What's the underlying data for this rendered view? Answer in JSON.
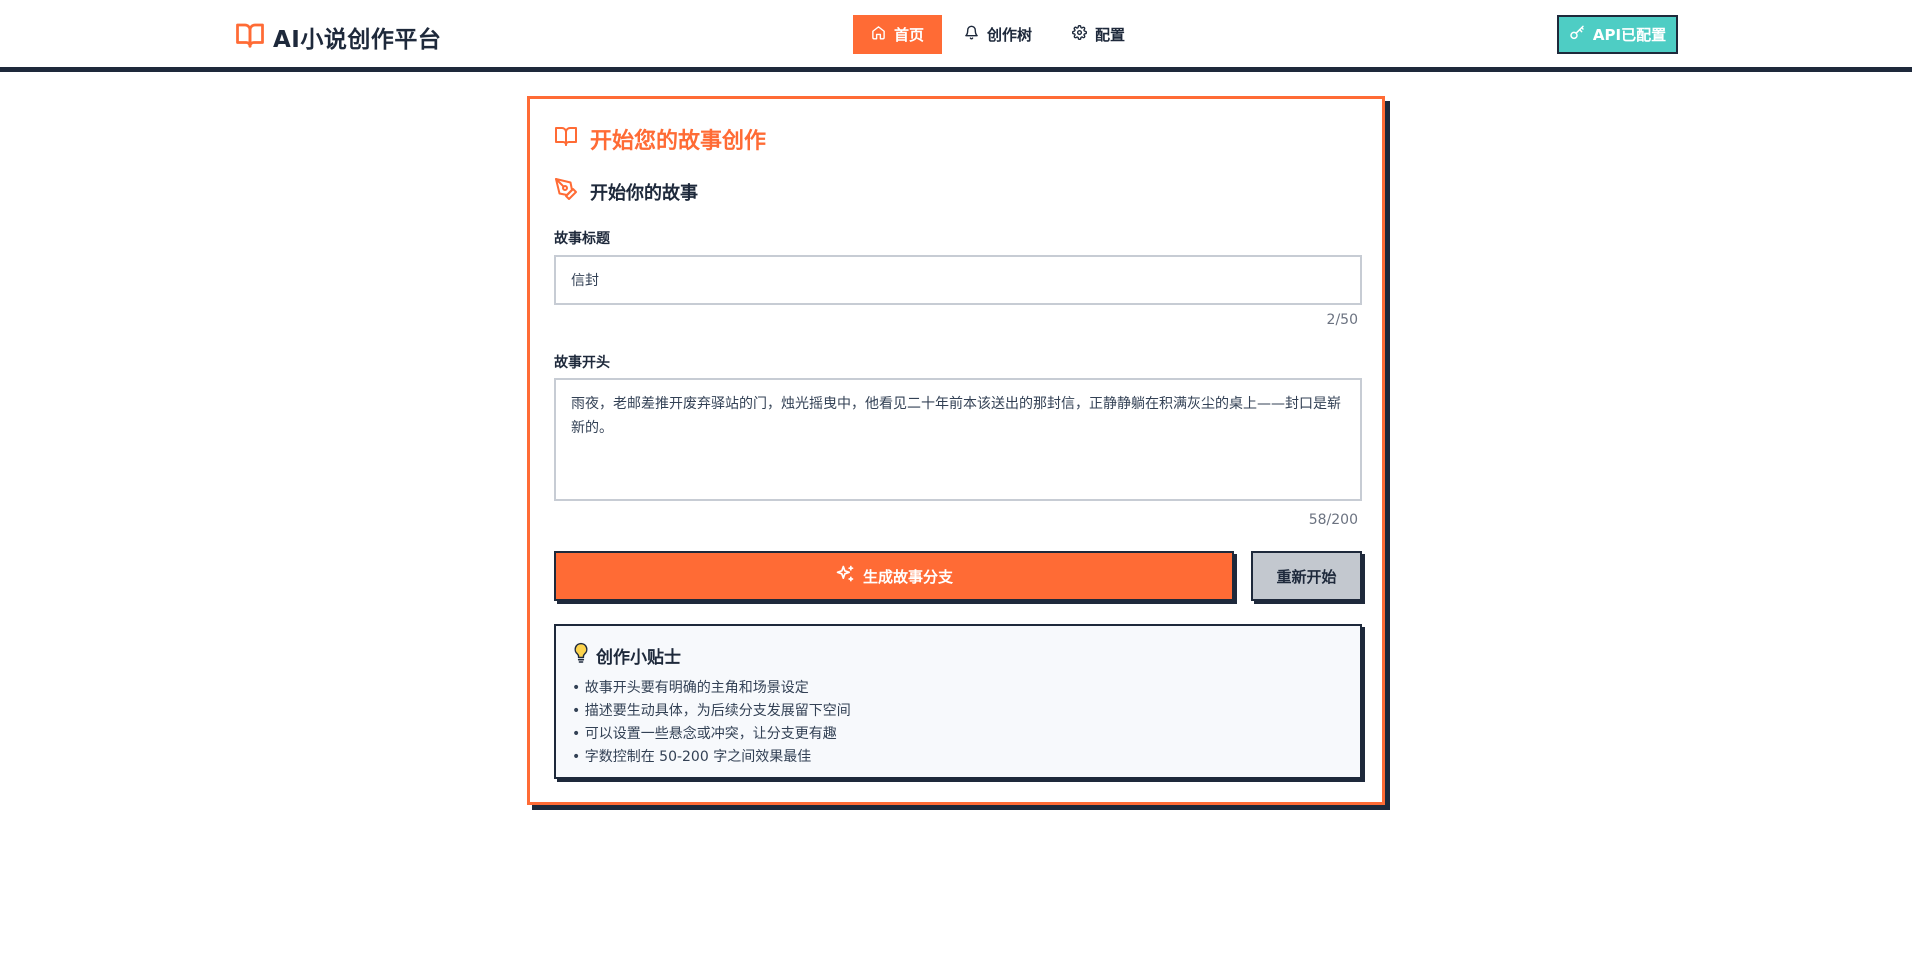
{
  "header": {
    "logo_text": "AI小说创作平台",
    "nav": [
      {
        "label": "首页",
        "active": true,
        "icon": "home-icon"
      },
      {
        "label": "创作树",
        "active": false,
        "icon": "bell-icon"
      },
      {
        "label": "配置",
        "active": false,
        "icon": "gear-icon"
      }
    ],
    "api_button_label": "API已配置"
  },
  "card": {
    "title": "开始您的故事创作",
    "subtitle": "开始你的故事",
    "title_field": {
      "label": "故事标题",
      "value": "信封",
      "counter": "2/50"
    },
    "opening_field": {
      "label": "故事开头",
      "value": "雨夜，老邮差推开废弃驿站的门，烛光摇曳中，他看见二十年前本该送出的那封信，正静静躺在积满灰尘的桌上——封口是崭新的。",
      "counter": "58/200"
    },
    "generate_button_label": "生成故事分支",
    "reset_button_label": "重新开始",
    "tips": {
      "title": "创作小贴士",
      "items": [
        "• 故事开头要有明确的主角和场景设定",
        "• 描述要生动具体，为后续分支发展留下空间",
        "• 可以设置一些悬念或冲突，让分支更有趣",
        "• 字数控制在 50-200 字之间效果最佳"
      ]
    }
  },
  "colors": {
    "accent": "#ff6b35",
    "teal": "#4ecdc4",
    "dark": "#1e293b"
  }
}
